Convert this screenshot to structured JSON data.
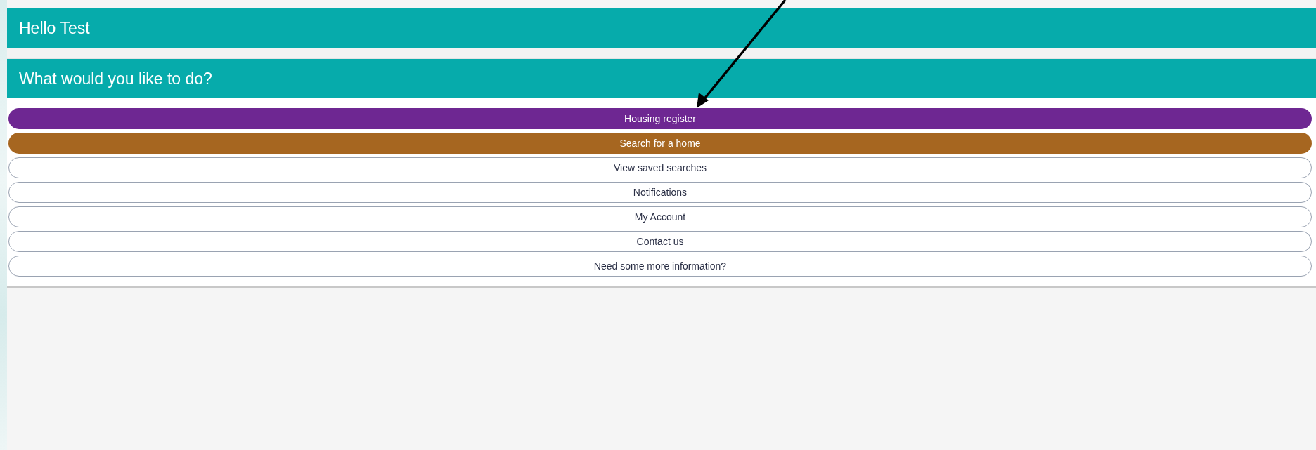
{
  "greeting": {
    "title": "Hello Test"
  },
  "prompt": {
    "title": "What would you like to do?"
  },
  "actions": [
    {
      "label": "Housing register",
      "kind": "filled",
      "color": "#6e2792"
    },
    {
      "label": "Search for a home",
      "kind": "filled",
      "color": "#a66620"
    },
    {
      "label": "View saved searches",
      "kind": "outline"
    },
    {
      "label": "Notifications",
      "kind": "outline"
    },
    {
      "label": "My Account",
      "kind": "outline"
    },
    {
      "label": "Contact us",
      "kind": "outline"
    },
    {
      "label": "Need some more information?",
      "kind": "outline"
    }
  ]
}
